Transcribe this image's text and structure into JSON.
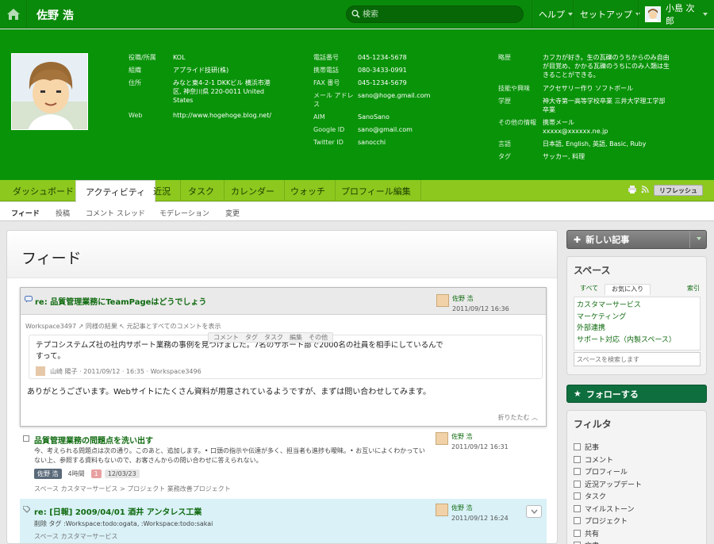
{
  "topbar": {
    "user_name": "佐野 浩",
    "search_placeholder": "検索",
    "help": "ヘルプ",
    "setup": "セットアップ",
    "current_user": "小島 次郎"
  },
  "profile": {
    "col1": [
      {
        "k": "役職/所属",
        "v": "KOL"
      },
      {
        "k": "組織",
        "v": "アプライド技研(株)"
      },
      {
        "k": "住所",
        "v": "みなと東4-2-1 DKKビル 横浜市港区, 神奈川県 220-0011 United States"
      },
      {
        "k": "Web",
        "v": "http://www.hogehoge.blog.net/"
      }
    ],
    "col2": [
      {
        "k": "電話番号",
        "v": "045-1234-5678"
      },
      {
        "k": "携帯電話",
        "v": "080-3433-0991"
      },
      {
        "k": "FAX 番号",
        "v": "045-1234-5679"
      },
      {
        "k": "メール アドレス",
        "v": "sano@hoge.gmail.com"
      },
      {
        "k": "AIM",
        "v": "SanoSano"
      },
      {
        "k": "Google ID",
        "v": "sano@gmail.com"
      },
      {
        "k": "Twitter ID",
        "v": "sanocchi"
      }
    ],
    "col3": [
      {
        "k": "略歴",
        "v": "カフカが好き。生の瓦礫のうちからのみ自由が目覚め、かかる瓦礫のうちにのみ人類は生きることができる。"
      },
      {
        "k": "技能や興味",
        "v": "アクセサリー作り ソフトボール"
      },
      {
        "k": "学歴",
        "v": "神大寺第一高等学校卒業 三井大学理工学部卒業"
      },
      {
        "k": "その他の情報",
        "v": "携帯メール xxxxx@xxxxxx.ne.jp"
      },
      {
        "k": "言語",
        "v": "日本語, English, 英語, Basic, Ruby"
      },
      {
        "k": "タグ",
        "v": "サッカー, 料理"
      }
    ]
  },
  "tabs": [
    "ダッシュボード",
    "アクティビティ",
    "近況",
    "タスク",
    "カレンダー",
    "ウォッチ",
    "プロフィール編集"
  ],
  "refresh": "リフレッシュ",
  "subnav": [
    "フィード",
    "投稿",
    "コメント スレッド",
    "モデレーション",
    "変更"
  ],
  "main": {
    "title": "フィード",
    "card": {
      "title": "re: 品質管理業務にTeamPageはどうでしょう",
      "user": "佐野 浩",
      "time": "2011/09/12 16:36",
      "breadcrumbs": "Workspace3497  ↗ 同様の結果  ↖ 元記事とすべてのコメントを表示",
      "actions": [
        "コメント",
        "タグ",
        "タスク",
        "編集",
        "その他"
      ],
      "quote": "テプコシステムズ社の社内サポート業務の事例を見つけました。7名のサポート部で2000名の社員を相手にしているんですって。",
      "quote_meta": "山崎 陽子 · 2011/09/12 · 16:35 · Workspace3496",
      "comment": "ありがとうございます。Webサイトにたくさん資料が用意されているようですが、まずは問い合わせしてみます。",
      "collapse": "折りたたむ"
    },
    "item2": {
      "title": "品質管理業務の問題点を洗い出す",
      "user": "佐野 浩",
      "time": "2011/09/12 16:31",
      "desc": "今、考えられる問題点は次の通り。このあと、追加します。• 口頭の指示や伝達が多く、担当者も進捗も曖昧。• お互いによくわかっていない上、参照する資料もないので、お客さんからの問い合わせに答えられない。",
      "owner_pill": "佐野 浩",
      "duration": "4時間",
      "count": "1",
      "date": "12/03/23",
      "space": "スペース カスタマーサービス > プロジェクト 業務改善プロジェクト"
    },
    "item3": {
      "title": "re: [日報] 2009/04/01 酒井 アンタレス工業",
      "user": "佐野 浩",
      "time": "2011/09/12 16:24",
      "tags": "削除 タグ :Workspace:todo:ogata, :Workspace:todo:sakai",
      "space": "スペース カスタマーサービス"
    }
  },
  "sidebar": {
    "new_article": "新しい記事",
    "space_heading": "スペース",
    "space_tabs": [
      "すべて",
      "お気に入り"
    ],
    "index": "索引",
    "spaces": [
      "カスタマーサービス",
      "マーケティング",
      "外部連携",
      "サポート対応（内製スペース）"
    ],
    "space_search_placeholder": "スペースを検索します",
    "follow": "フォローする",
    "filter_heading": "フィルタ",
    "filters": [
      "記事",
      "コメント",
      "プロフィール",
      "近況アップデート",
      "タスク",
      "マイルストーン",
      "プロジェクト",
      "共有",
      "文書"
    ]
  },
  "colors": {
    "topbar": "#0a8a0a",
    "profile_bg": "#099309",
    "tabbar": "#8cc81e",
    "link": "#0f6a0f",
    "follow_button": "#0e6e3e",
    "highlight_row": "#d9f1f7"
  }
}
